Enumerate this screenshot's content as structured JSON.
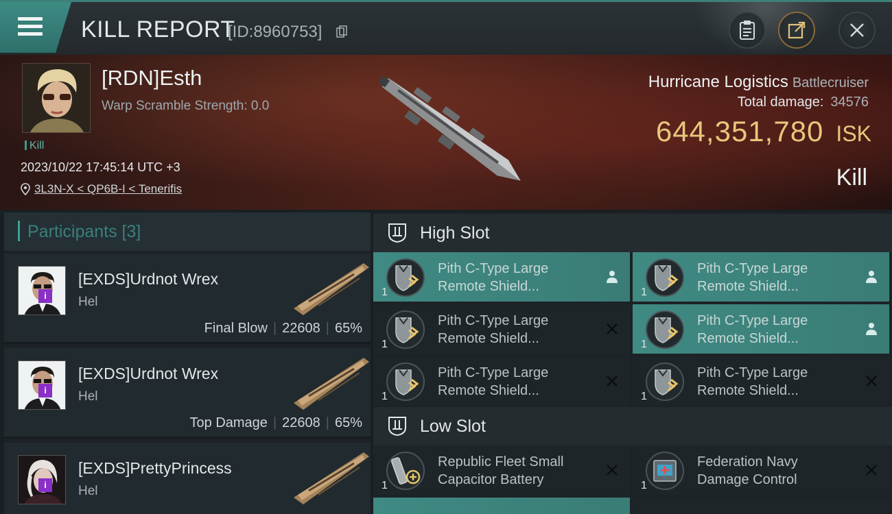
{
  "header": {
    "title": "KILL REPORT",
    "report_id": "[ID:8960753]"
  },
  "victim": {
    "name": "[RDN]Esth",
    "warp_scramble": "Warp Scramble Strength: 0.0",
    "tag": "Kill",
    "datetime": "2023/10/22 17:45:14 UTC +3",
    "location": "3L3N-X < QP6B-I < Tenerifis",
    "ship_name": "Hurricane Logistics",
    "ship_class": "Battlecruiser",
    "total_damage_label": "Total damage:",
    "total_damage": "34576",
    "isk_value": "644,351,780",
    "isk_unit": "ISK",
    "result": "Kill"
  },
  "participants": {
    "title": "Participants [3]",
    "rows": [
      {
        "name": "[EXDS]Urdnot Wrex",
        "ship": "Hel",
        "role": "Final Blow",
        "damage": "22608",
        "percent": "65%"
      },
      {
        "name": "[EXDS]Urdnot Wrex",
        "ship": "Hel",
        "role": "Top Damage",
        "damage": "22608",
        "percent": "65%"
      },
      {
        "name": "[EXDS]PrettyPrincess",
        "ship": "Hel",
        "role": "",
        "damage": "",
        "percent": ""
      }
    ]
  },
  "fitting": {
    "high_slot_label": "High Slot",
    "low_slot_label": "Low Slot",
    "high": [
      {
        "qty": "1",
        "name1": "Pith C-Type Large",
        "name2": "Remote Shield...",
        "state": "user",
        "active": true
      },
      {
        "qty": "1",
        "name1": "Pith C-Type Large",
        "name2": "Remote Shield...",
        "state": "user",
        "active": true
      },
      {
        "qty": "1",
        "name1": "Pith C-Type Large",
        "name2": "Remote Shield...",
        "state": "destroyed",
        "active": false
      },
      {
        "qty": "1",
        "name1": "Pith C-Type Large",
        "name2": "Remote Shield...",
        "state": "user",
        "active": true
      },
      {
        "qty": "1",
        "name1": "Pith C-Type Large",
        "name2": "Remote Shield...",
        "state": "destroyed",
        "active": false
      },
      {
        "qty": "1",
        "name1": "Pith C-Type Large",
        "name2": "Remote Shield...",
        "state": "destroyed",
        "active": false
      }
    ],
    "low": [
      {
        "qty": "1",
        "name1": "Republic Fleet Small",
        "name2": "Capacitor Battery",
        "state": "destroyed",
        "active": false
      },
      {
        "qty": "1",
        "name1": "Federation Navy",
        "name2": "Damage Control",
        "state": "destroyed",
        "active": false
      }
    ]
  },
  "colors": {
    "accent": "#3f8a83",
    "isk": "#e8c77b",
    "badge": "#8a2fc7"
  }
}
